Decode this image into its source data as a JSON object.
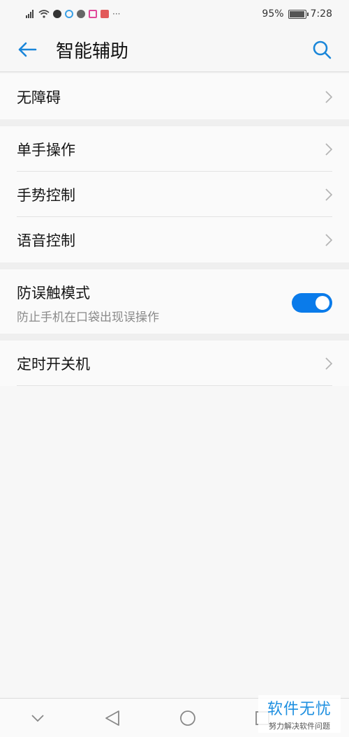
{
  "status_bar": {
    "battery": "95%",
    "time": "7:28",
    "more": "···"
  },
  "header": {
    "title": "智能辅助"
  },
  "groups": {
    "g1": [
      "无障碍"
    ],
    "g2": [
      "单手操作",
      "手势控制",
      "语音控制"
    ],
    "toggle": {
      "label": "防误触模式",
      "description": "防止手机在口袋出现误操作",
      "on": true
    },
    "g4": [
      "定时开关机"
    ]
  },
  "watermark": {
    "title": "软件无忧",
    "subtitle": "努力解决软件问题"
  },
  "colors": {
    "accent": "#0a7bea",
    "background": "#f7f7f7"
  }
}
